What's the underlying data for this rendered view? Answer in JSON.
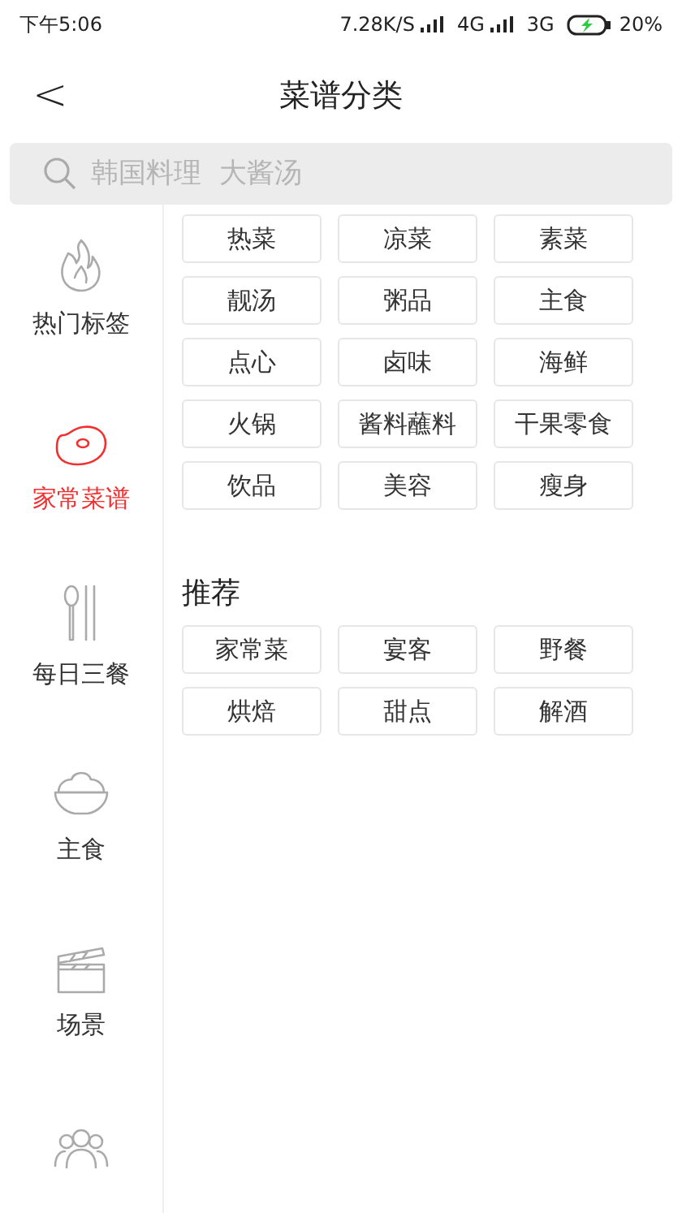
{
  "status_bar": {
    "time": "下午5:06",
    "speed": "7.28K/S",
    "network_1": "4G",
    "network_2": "3G",
    "battery": "20%",
    "charging": true
  },
  "header": {
    "back": "<",
    "title": "菜谱分类"
  },
  "search": {
    "placeholder": "韩国料理  大酱汤"
  },
  "sidebar": {
    "items": [
      {
        "kind": "fire",
        "label": "热门标签",
        "selected": false
      },
      {
        "kind": "meat",
        "label": "家常菜谱",
        "selected": true
      },
      {
        "kind": "cutlery",
        "label": "每日三餐",
        "selected": false
      },
      {
        "kind": "bowl",
        "label": "主食",
        "selected": false
      },
      {
        "kind": "clapper",
        "label": "场景",
        "selected": false
      },
      {
        "kind": "people",
        "selected": false
      }
    ]
  },
  "sections": [
    {
      "tags": [
        "热菜",
        "凉菜",
        "素菜",
        "靓汤",
        "粥品",
        "主食",
        "点心",
        "卤味",
        "海鲜",
        "火锅",
        "酱料蘸料",
        "干果零食",
        "饮品",
        "美容",
        "瘦身"
      ]
    },
    {
      "title": "推荐",
      "tags": [
        "家常菜",
        "宴客",
        "野餐",
        "烘焙",
        "甜点",
        "解酒"
      ]
    }
  ]
}
